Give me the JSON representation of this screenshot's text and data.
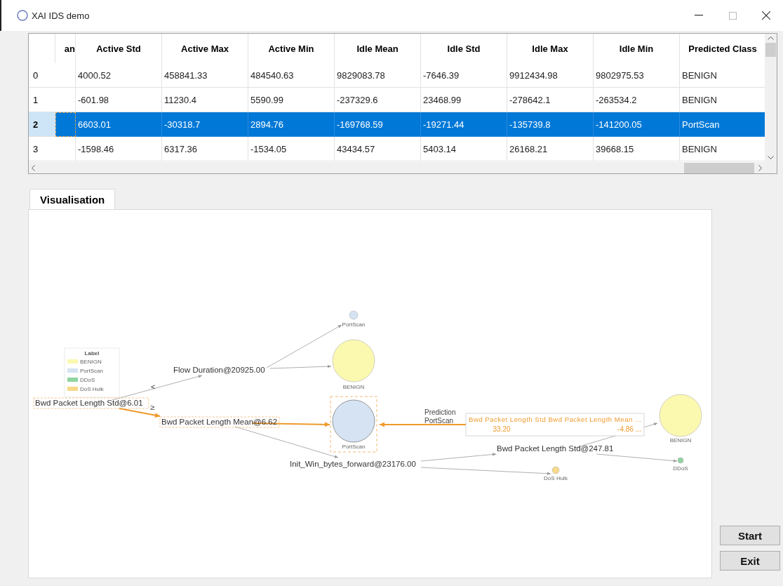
{
  "window": {
    "title": "XAI IDS demo"
  },
  "table": {
    "columns": [
      "an",
      "Active Std",
      "Active Max",
      "Active Min",
      "Idle Mean",
      "Idle Std",
      "Idle Max",
      "Idle Min",
      "Predicted Class"
    ],
    "rows": [
      {
        "index": "0",
        "selected": false,
        "cells": [
          "",
          "4000.52",
          "458841.33",
          "484540.63",
          "9829083.78",
          "-7646.39",
          "9912434.98",
          "9802975.53",
          "BENIGN"
        ]
      },
      {
        "index": "1",
        "selected": false,
        "cells": [
          "",
          "-601.98",
          "11230.4",
          "5590.99",
          "-237329.6",
          "23468.99",
          "-278642.1",
          "-263534.2",
          "BENIGN"
        ]
      },
      {
        "index": "2",
        "selected": true,
        "cells": [
          "",
          "6603.01",
          "-30318.7",
          "2894.76",
          "-169768.59",
          "-19271.44",
          "-135739.8",
          "-141200.05",
          "PortScan"
        ]
      },
      {
        "index": "3",
        "selected": false,
        "cells": [
          "",
          "-1598.46",
          "6317.36",
          "-1534.05",
          "43434.57",
          "5403.14",
          "26168.21",
          "39668.15",
          "BENIGN"
        ]
      }
    ]
  },
  "tabs": [
    {
      "label": "Visualisation",
      "selected": true
    }
  ],
  "visualisation": {
    "legend": {
      "title": "Label",
      "entries": [
        {
          "label": "BENIGN",
          "color": "#fbf8b0"
        },
        {
          "label": "PortScan",
          "color": "#d5e3f3"
        },
        {
          "label": "DDoS",
          "color": "#90d4a0"
        },
        {
          "label": "DoS Hulk",
          "color": "#f7d98a"
        }
      ]
    },
    "splits": [
      {
        "label": "Bwd Packet Length Std@6.01",
        "highlighted": true
      },
      {
        "label": "Flow Duration@20925.00",
        "highlighted": false
      },
      {
        "label": "Bwd Packet Length Mean@6.62",
        "highlighted": true
      },
      {
        "label": "Init_Win_bytes_forward@23176.00",
        "highlighted": false
      },
      {
        "label": "Bwd Packet Length Std@247.81",
        "highlighted": false
      }
    ],
    "branch_labels": [
      "<",
      "≥"
    ],
    "leaves": [
      {
        "label": "PortScan",
        "color": "#d5e3f3",
        "highlighted": false
      },
      {
        "label": "BENIGN",
        "color": "#fbf8b0",
        "highlighted": false
      },
      {
        "label": "PortScan",
        "color": "#d5e3f3",
        "highlighted": true
      },
      {
        "label": "BENIGN",
        "color": "#fbf8b0",
        "highlighted": false
      },
      {
        "label": "DoS Hulk",
        "color": "#f7d98a",
        "highlighted": false
      },
      {
        "label": "DDoS",
        "color": "#90d4a0",
        "highlighted": false
      }
    ],
    "edges": [
      {
        "highlighted": false
      },
      {
        "highlighted": false
      },
      {
        "highlighted": false
      },
      {
        "highlighted": true
      },
      {
        "highlighted": true
      },
      {
        "highlighted": true
      },
      {
        "highlighted": false
      },
      {
        "highlighted": false
      },
      {
        "highlighted": false
      },
      {
        "highlighted": false
      },
      {
        "highlighted": false
      }
    ],
    "prediction": {
      "caption": [
        "Prediction",
        "PortScan"
      ],
      "header": "Bwd Packet Length Std Bwd Packet Length Mean ...",
      "values": [
        "33.20",
        "-4.86 ..."
      ]
    }
  },
  "buttons": [
    "Start",
    "Exit"
  ]
}
